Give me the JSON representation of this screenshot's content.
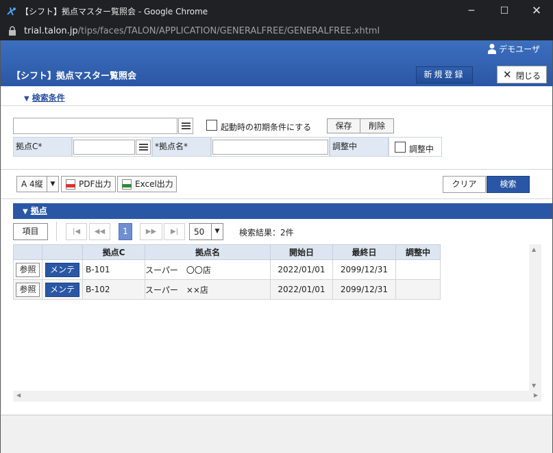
{
  "window": {
    "title": "【シフト】拠点マスター覧照会 - Google Chrome",
    "url_host": "trial.talon.jp",
    "url_path": "/tips/faces/TALON/APPLICATION/GENERALFREE/GENERALFREE.xhtml",
    "minimize_glyph": "─",
    "maximize_glyph": "☐",
    "close_glyph": "✕"
  },
  "header": {
    "user_name": "デモユーザ",
    "page_title": "【シフト】拠点マスター覧照会",
    "new_button": "新規登録",
    "close_button": "閉じる",
    "close_glyph": "✕"
  },
  "search": {
    "toggle_label": "検索条件",
    "toggle_glyph": "▼",
    "condition_value": "",
    "startup_label": "起動時の初期条件にする",
    "save_label": "保存",
    "delete_label": "削除",
    "base_code_label": "拠点C*",
    "base_code_value": "",
    "base_name_label": "*拠点名*",
    "base_name_value": "",
    "adjusting_label": "調整中",
    "adjusting_checkbox_label": "調整中"
  },
  "toolbar": {
    "paper_value": "A 4縦",
    "dropdown_glyph": "▼",
    "pdf_label": "PDF出力",
    "excel_label": "Excel出力",
    "clear_label": "クリア",
    "search_label": "検索"
  },
  "section": {
    "title": "拠点",
    "glyph": "▼"
  },
  "pager": {
    "items_label": "項目",
    "first_glyph": "|◀",
    "prev_glyph": "◀◀",
    "current_page": "1",
    "next_glyph": "▶▶",
    "last_glyph": "▶|",
    "page_size": "50",
    "page_size_glyph": "▼",
    "result_text": "検索結果：2件"
  },
  "grid": {
    "columns": [
      "",
      "",
      "拠点C",
      "拠点名",
      "開始日",
      "最終日",
      "調整中"
    ],
    "ref_label": "参照",
    "maint_label": "メンテ",
    "rows": [
      {
        "code": "B-101",
        "name": "スーパー　〇〇店",
        "start": "2022/01/01",
        "end": "2099/12/31",
        "adjusting": ""
      },
      {
        "code": "B-102",
        "name": "スーパー　××店",
        "start": "2022/01/01",
        "end": "2099/12/31",
        "adjusting": ""
      }
    ]
  },
  "scrollbars": {
    "up": "▲",
    "down": "▼",
    "left": "◀",
    "right": "▶"
  },
  "colors": {
    "header_blue": "#2a57a5",
    "label_bg": "#e0e8f3",
    "page_current": "#6f8fd0"
  }
}
